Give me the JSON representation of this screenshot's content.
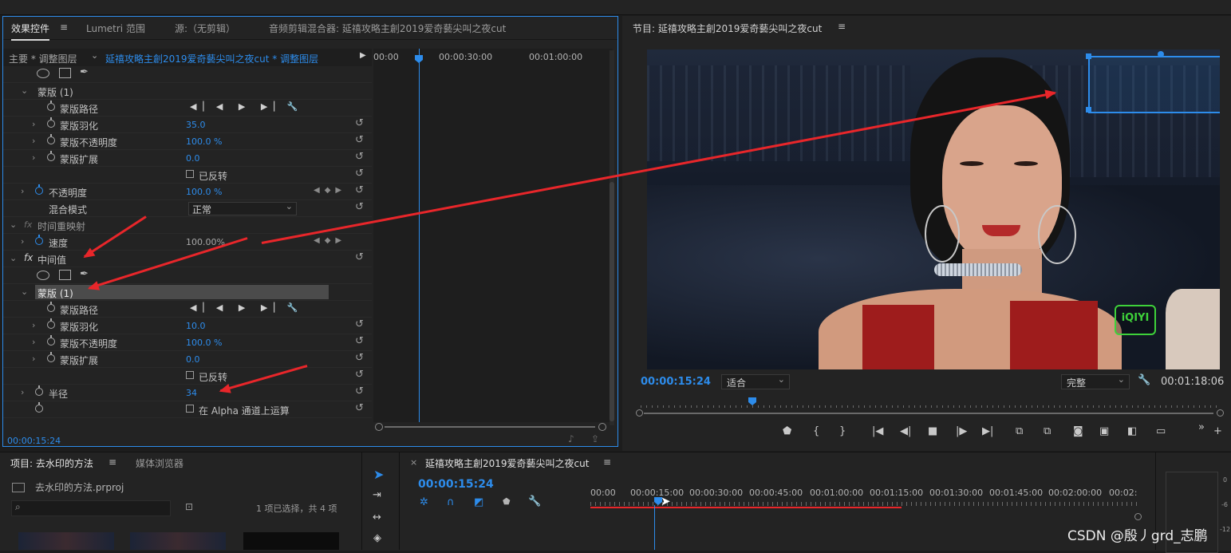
{
  "effect_controls": {
    "tabs": [
      "效果控件",
      "Lumetri 范围",
      "源:（无剪辑）",
      "音频剪辑混合器: 延禧攻略主創2019爱奇藝尖叫之夜cut"
    ],
    "master_label": "主要 * 调整图层",
    "sequence_path": "延禧攻略主創2019爱奇藝尖叫之夜cut * 调整图层",
    "timecodes": [
      "00:00",
      "00:00:30:00",
      "00:01:00:00"
    ],
    "current_time": "00:00:15:24",
    "rows": [
      {
        "label": "蒙版 (1)",
        "value": ""
      },
      {
        "label": "蒙版路径",
        "value": ""
      },
      {
        "label": "蒙版羽化",
        "value": "35.0"
      },
      {
        "label": "蒙版不透明度",
        "value": "100.0 %"
      },
      {
        "label": "蒙版扩展",
        "value": "0.0"
      },
      {
        "label": "已反转",
        "value": ""
      },
      {
        "label": "不透明度",
        "value": "100.0 %"
      },
      {
        "label": "混合模式",
        "value": "正常"
      },
      {
        "label": "时间重映射",
        "value": ""
      },
      {
        "label": "速度",
        "value": "100.00%"
      },
      {
        "label": "中间值",
        "value": ""
      },
      {
        "label": "蒙版 (1)",
        "value": ""
      },
      {
        "label": "蒙版路径",
        "value": ""
      },
      {
        "label": "蒙版羽化",
        "value": "10.0"
      },
      {
        "label": "蒙版不透明度",
        "value": "100.0 %"
      },
      {
        "label": "蒙版扩展",
        "value": "0.0"
      },
      {
        "label": "已反转",
        "value": ""
      },
      {
        "label": "半径",
        "value": "34"
      },
      {
        "label": "在 Alpha 通道上运算",
        "value": ""
      }
    ]
  },
  "program_monitor": {
    "title": "节目: 延禧攻略主創2019爱奇藝尖叫之夜cut",
    "current_time": "00:00:15:24",
    "fit": "适合",
    "quality": "完整",
    "duration": "00:01:18:06",
    "watermark_text": "iQIYI"
  },
  "project": {
    "tabs": [
      "项目: 去水印的方法",
      "媒体浏览器"
    ],
    "file_name": "去水印的方法.prproj",
    "selection_info": "1 项已选择，共 4 项"
  },
  "timeline": {
    "title": "延禧攻略主創2019爱奇藝尖叫之夜cut",
    "current_time": "00:00:15:24",
    "ruler": [
      "00:00",
      "00:00:15:00",
      "00:00:30:00",
      "00:00:45:00",
      "00:01:00:00",
      "00:01:15:00",
      "00:01:30:00",
      "00:01:45:00",
      "00:02:00:00",
      "00:02:"
    ]
  },
  "meter_labels": [
    "0",
    "-6",
    "-12"
  ],
  "csdn_watermark": "CSDN @殷丿grd_志鹏",
  "colors": {
    "accent": "#2d8ceb",
    "arrow": "#e8262a",
    "bg": "#232323"
  }
}
